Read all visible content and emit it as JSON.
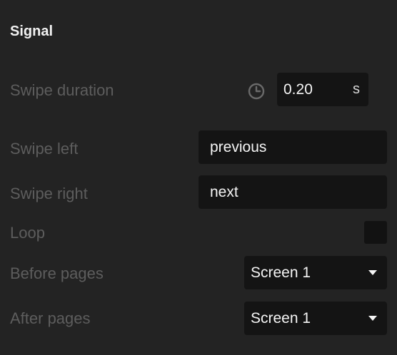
{
  "section": {
    "title": "Signal"
  },
  "rows": {
    "swipe_duration": {
      "label": "Swipe duration",
      "value": "0.20",
      "unit": "s",
      "icon": "clock-icon"
    },
    "swipe_left": {
      "label": "Swipe left",
      "value": "previous"
    },
    "swipe_right": {
      "label": "Swipe right",
      "value": "next"
    },
    "loop": {
      "label": "Loop",
      "checked": false
    },
    "before_pages": {
      "label": "Before pages",
      "selected": "Screen 1"
    },
    "after_pages": {
      "label": "After pages",
      "selected": "Screen 1"
    }
  }
}
